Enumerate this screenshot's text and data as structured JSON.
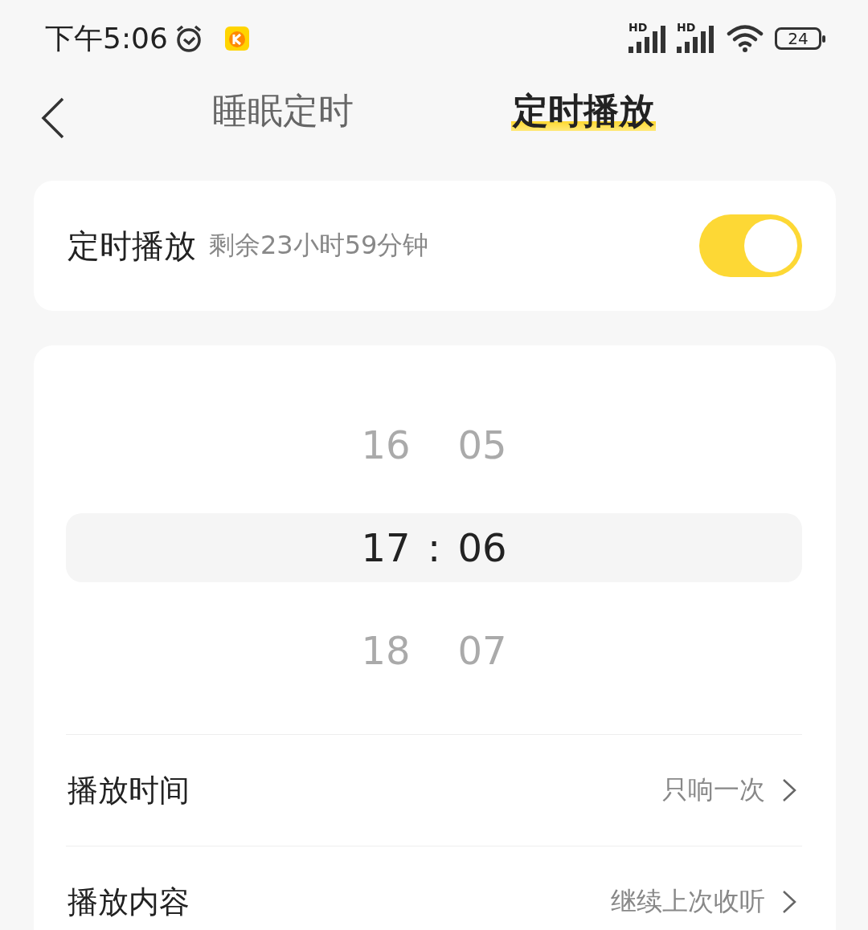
{
  "status_bar": {
    "time": "下午5:06",
    "network_labels": [
      "HD",
      "HD"
    ],
    "battery": "24"
  },
  "tabs": [
    {
      "label": "睡眠定时",
      "selected": false
    },
    {
      "label": "定时播放",
      "selected": true
    }
  ],
  "timer": {
    "title": "定时播放",
    "remaining": "剩余23小时59分钟",
    "on": true
  },
  "picker": {
    "separator": ":",
    "rows": [
      {
        "hour": "16",
        "minute": "05",
        "selected": false
      },
      {
        "hour": "17",
        "minute": "06",
        "selected": true
      },
      {
        "hour": "18",
        "minute": "07",
        "selected": false
      }
    ]
  },
  "settings": [
    {
      "label": "播放时间",
      "value": "只响一次"
    },
    {
      "label": "播放内容",
      "value": "继续上次收听"
    }
  ]
}
